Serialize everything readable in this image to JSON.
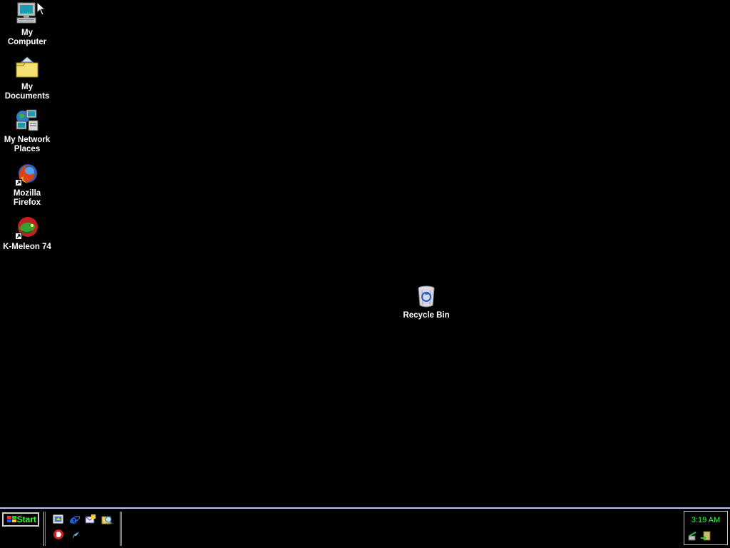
{
  "desktop": {
    "background": "#000000",
    "icons": [
      {
        "label": "My\nComputer",
        "icon": "my-computer-icon"
      },
      {
        "label": "My\nDocuments",
        "icon": "my-documents-icon"
      },
      {
        "label": "My Network\nPlaces",
        "icon": "network-places-icon"
      },
      {
        "label": "Mozilla\nFirefox",
        "icon": "firefox-icon"
      },
      {
        "label": "K-Meleon 74",
        "icon": "k-meleon-icon"
      },
      {
        "label": "Recycle Bin",
        "icon": "recycle-bin-icon"
      }
    ]
  },
  "taskbar": {
    "start_label": "Start",
    "accent": "#33ff33",
    "border_color": "#c0c0ff",
    "quick_launch": [
      {
        "icon": "show-desktop-icon"
      },
      {
        "icon": "internet-explorer-icon"
      },
      {
        "icon": "outlook-express-icon"
      },
      {
        "icon": "windows-explorer-icon"
      },
      {
        "icon": "media-player-icon"
      },
      {
        "icon": "messenger-icon"
      }
    ],
    "tray": {
      "clock": "3:19 AM",
      "icons": [
        {
          "icon": "network-tray-icon"
        },
        {
          "icon": "safely-remove-tray-icon"
        }
      ]
    }
  }
}
